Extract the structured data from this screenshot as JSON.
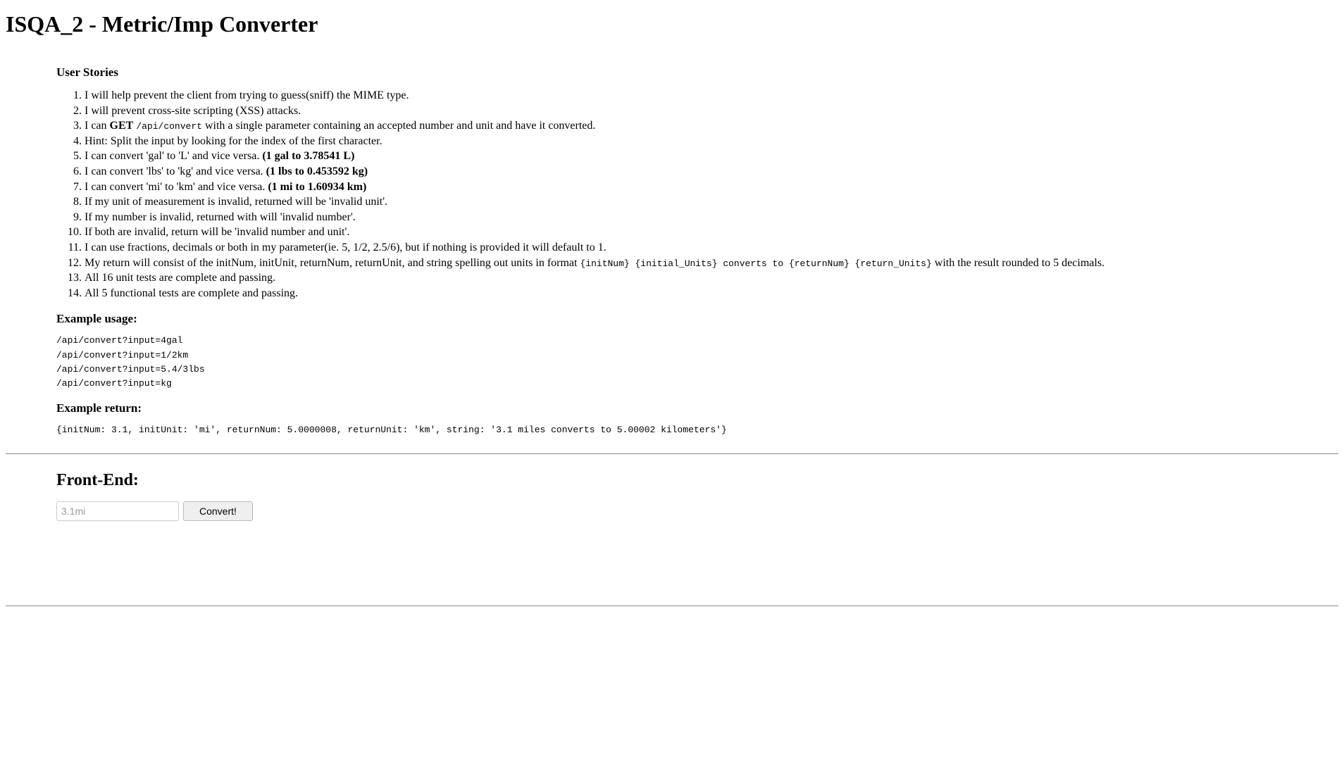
{
  "page_title": "ISQA_2 - Metric/Imp Converter",
  "user_stories": {
    "heading": "User Stories",
    "items": [
      "I will help prevent the client from trying to guess(sniff) the MIME type.",
      "I will prevent cross-site scripting (XSS) attacks.",
      "",
      "Hint: Split the input by looking for the index of the first character.",
      "",
      "",
      "",
      "If my unit of measurement is invalid, returned will be 'invalid unit'.",
      "If my number is invalid, returned with will 'invalid number'.",
      "If both are invalid, return will be 'invalid number and unit'.",
      "I can use fractions, decimals or both in my parameter(ie. 5, 1/2, 2.5/6), but if nothing is provided it will default to 1.",
      "",
      "All 16 unit tests are complete and passing.",
      "All 5 functional tests are complete and passing."
    ],
    "item3_prefix": "I can ",
    "item3_get": "GET",
    "item3_code": "/api/convert",
    "item3_suffix": " with a single parameter containing an accepted number and unit and have it converted.",
    "item5_prefix": "I can convert 'gal' to 'L' and vice versa. ",
    "item5_bold": "(1 gal to 3.78541 L)",
    "item6_prefix": "I can convert 'lbs' to 'kg' and vice versa. ",
    "item6_bold": "(1 lbs to 0.453592 kg)",
    "item7_prefix": "I can convert 'mi' to 'km' and vice versa. ",
    "item7_bold": "(1 mi to 1.60934 km)",
    "item12_prefix": "My return will consist of the initNum, initUnit, returnNum, returnUnit, and string spelling out units in format ",
    "item12_code": "{initNum} {initial_Units} converts to {returnNum} {return_Units}",
    "item12_suffix": " with the result rounded to 5 decimals."
  },
  "example_usage": {
    "heading": "Example usage:",
    "lines": [
      "/api/convert?input=4gal",
      "/api/convert?input=1/2km",
      "/api/convert?input=5.4/3lbs",
      "/api/convert?input=kg"
    ]
  },
  "example_return": {
    "heading": "Example return:",
    "line": "{initNum: 3.1, initUnit: 'mi', returnNum: 5.0000008, returnUnit: 'km', string: '3.1 miles converts to 5.00002 kilometers'}"
  },
  "front_end": {
    "heading": "Front-End:",
    "input_placeholder": "3.1mi",
    "button_label": "Convert!"
  }
}
